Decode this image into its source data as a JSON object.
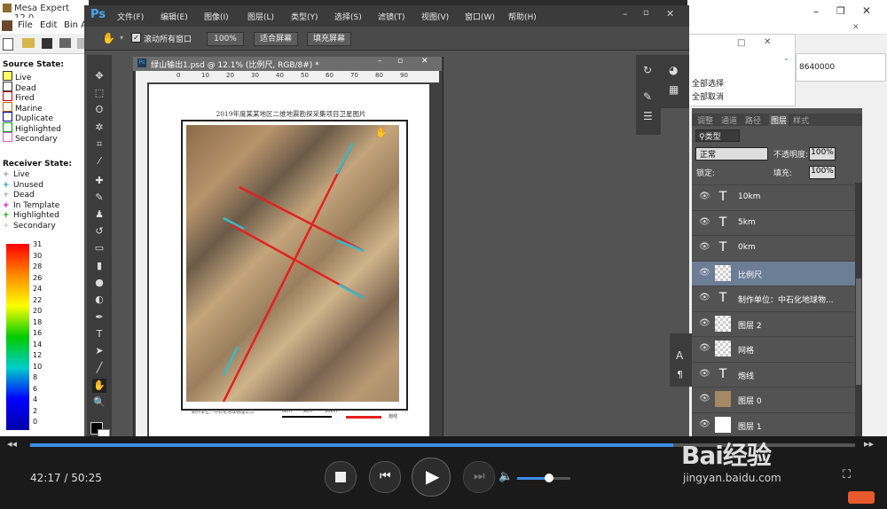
{
  "mesa": {
    "title": "Mesa Expert 12.0",
    "menu": [
      "File",
      "Edit",
      "Bin A"
    ],
    "source_state_title": "Source State:",
    "source_states": [
      {
        "label": "Live",
        "color": "#ffff66"
      },
      {
        "label": "Dead",
        "color": "#ffffff"
      },
      {
        "label": "Fired",
        "color": "#ffffff",
        "border": "#cc0000"
      },
      {
        "label": "Marine",
        "color": "#ffffff",
        "border": "#cc6600"
      },
      {
        "label": "Duplicate",
        "color": "#ffffff",
        "border": "#000099"
      },
      {
        "label": "Highlighted",
        "color": "#ffffff",
        "border": "#009900"
      },
      {
        "label": "Secondary",
        "color": "#ffffff",
        "border": "#cc66cc"
      }
    ],
    "receiver_state_title": "Receiver State:",
    "receiver_states": [
      {
        "label": "Live",
        "color": "#999999"
      },
      {
        "label": "Unused",
        "color": "#00aaaa"
      },
      {
        "label": "Dead",
        "color": "#aaaaaa"
      },
      {
        "label": "In Template",
        "color": "#cc00cc"
      },
      {
        "label": "Highlighted",
        "color": "#00aa00"
      },
      {
        "label": "Secondary",
        "color": "#cccccc"
      }
    ],
    "scale_ticks": [
      "31",
      "30",
      "28",
      "26",
      "24",
      "22",
      "20",
      "18",
      "16",
      "14",
      "12",
      "10",
      "8",
      "6",
      "4",
      "2",
      "0"
    ]
  },
  "right_window": {
    "value": "8640000",
    "menu_items": [
      "全部选择",
      "全部取消"
    ]
  },
  "photoshop": {
    "logo": "Ps",
    "menus": [
      "文件(F)",
      "编辑(E)",
      "图像(I)",
      "图层(L)",
      "类型(Y)",
      "选择(S)",
      "滤镜(T)",
      "视图(V)",
      "窗口(W)",
      "帮助(H)"
    ],
    "options": {
      "scroll_all": "滚动所有窗口",
      "zoom": "100%",
      "fit_screen": "适合屏幕",
      "fill_screen": "填充屏幕"
    },
    "doc_title": "绿山输出1.psd @ 12.1% (比例尺, RGB/8#) *",
    "ruler_ticks": [
      "0",
      "10",
      "20",
      "30",
      "40",
      "50",
      "60",
      "70",
      "80",
      "90"
    ],
    "map_title": "2019年度某某地区二维地震勘探采集项目卫星图片",
    "map_footer": "制作单位：中石化地球物理公司",
    "map_legend_label": "炮线",
    "scale_labels": [
      "0km",
      "5km",
      "10km"
    ],
    "layers_panel": {
      "tabs": [
        "调整",
        "通道",
        "路径",
        "图层",
        "样式"
      ],
      "active_tab": "图层",
      "filter_kind": "类型",
      "blend_mode": "正常",
      "opacity_label": "不透明度:",
      "opacity": "100%",
      "lock_label": "锁定:",
      "fill_label": "填充:",
      "fill": "100%",
      "layers": [
        {
          "name": "10km",
          "kind": "text"
        },
        {
          "name": "5km",
          "kind": "text"
        },
        {
          "name": "0km",
          "kind": "text"
        },
        {
          "name": "比例尺",
          "kind": "pixel",
          "selected": true
        },
        {
          "name": "制作单位：中石化地球物...",
          "kind": "text"
        },
        {
          "name": "图层 2",
          "kind": "pixel"
        },
        {
          "name": "网格",
          "kind": "pixel"
        },
        {
          "name": "炮线",
          "kind": "text"
        },
        {
          "name": "图层 0",
          "kind": "image"
        },
        {
          "name": "图层 1",
          "kind": "white"
        }
      ]
    }
  },
  "player": {
    "time": "42:17 / 50:25",
    "progress": 0.78,
    "volume": 0.6,
    "watermark": "Bai经验",
    "watermark_url": "jingyan.baidu.com"
  }
}
